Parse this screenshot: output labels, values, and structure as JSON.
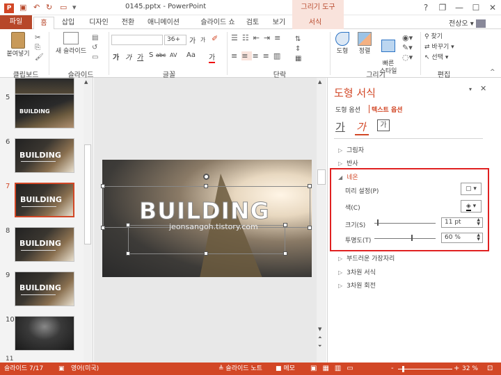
{
  "window": {
    "title": "0145.pptx - PowerPoint",
    "context_tool": "그리기 도구",
    "user": "전상오",
    "buttons": {
      "help": "?",
      "restore": "❐",
      "minimize": "—",
      "maximize": "☐",
      "close": "✕"
    }
  },
  "tabs": [
    "파일",
    "홈",
    "삽입",
    "디자인",
    "전환",
    "애니메이션",
    "슬라이드 쇼",
    "검토",
    "보기",
    "서식"
  ],
  "ribbon": {
    "clipboard": {
      "paste": "붙여넣기",
      "label": "클립보드"
    },
    "slides": {
      "new_slide": "새 슬라이드",
      "label": "슬라이드"
    },
    "font": {
      "size": "36+",
      "label": "글꼴",
      "bold": "가",
      "italic": "가",
      "underline": "가",
      "shadow": "S",
      "strike": "abc",
      "spacing": "AV",
      "case": "Aa",
      "color": "가",
      "grow": "가",
      "shrink": "가"
    },
    "paragraph": {
      "label": "단락"
    },
    "drawing": {
      "shape": "도형",
      "arrange": "정렬",
      "quick_styles": "빠른\n스타일",
      "label": "그리기"
    },
    "editing": {
      "find": "찾기",
      "replace": "바꾸기",
      "select": "선택",
      "label": "편집"
    }
  },
  "slides": [
    {
      "num": "5",
      "title": "BUILDING"
    },
    {
      "num": "6",
      "title": "BUILDING"
    },
    {
      "num": "7",
      "title": "BUILDING",
      "selected": true
    },
    {
      "num": "8",
      "title": "BUILDING"
    },
    {
      "num": "9",
      "title": "BUILDING"
    },
    {
      "num": "10",
      "title": ""
    }
  ],
  "slide": {
    "title": "BUILDING",
    "subtitle": "jeonsangoh.tistory.com"
  },
  "pane": {
    "title": "도형 서식",
    "tab_shape": "도형 옵션",
    "tab_text": "텍스트 옵션",
    "icon_tabs": [
      "가",
      "가",
      "가"
    ],
    "sections": {
      "shadow": "그림자",
      "reflection": "반사",
      "neon": "네온",
      "soft_edges": "부드러운 가장자리",
      "format_3d": "3차원 서식",
      "rotation_3d": "3차원 회전"
    },
    "neon": {
      "preset_label": "미리 설정(P)",
      "color_label": "색(C)",
      "size_label": "크기(S)",
      "size_value": "11 pt",
      "size_level": 0.05,
      "transparency_label": "투명도(T)",
      "transparency_value": "60 %",
      "transparency_level": 0.6
    }
  },
  "status": {
    "slide_info": "슬라이드 7/17",
    "language": "영어(미국)",
    "notes": "슬라이드 노트",
    "memo": "메모",
    "zoom": "32 %",
    "zoom_minus": "-",
    "zoom_plus": "+"
  },
  "colors": {
    "accent": "#d24726",
    "highlight_box": "#e02020"
  }
}
